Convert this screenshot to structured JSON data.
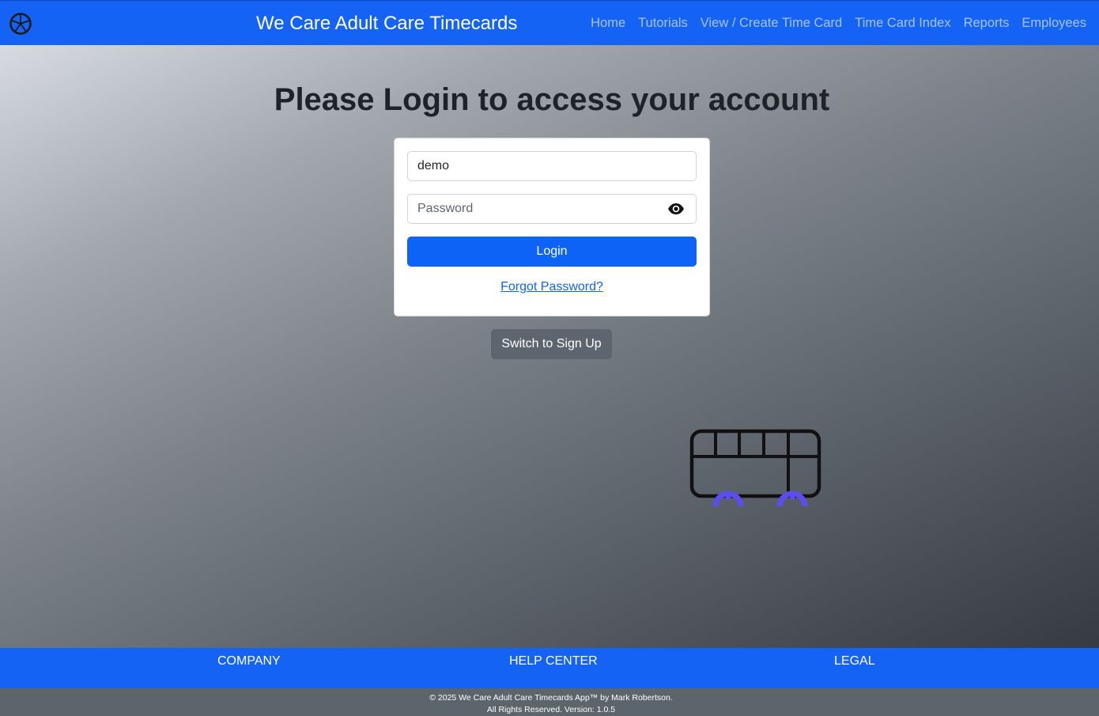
{
  "header": {
    "title": "We Care Adult Care Timecards",
    "logo_icon": "wheel-icon",
    "nav": [
      {
        "label": "Home"
      },
      {
        "label": "Tutorials"
      },
      {
        "label": "View / Create Time Card"
      },
      {
        "label": "Time Card Index"
      },
      {
        "label": "Reports"
      },
      {
        "label": "Employees"
      }
    ]
  },
  "main": {
    "heading": "Please Login to access your account",
    "login_form": {
      "username_value": "demo",
      "password_value": "",
      "password_placeholder": "Password",
      "show_password_icon": "eye-icon",
      "login_label": "Login",
      "forgot_label": "Forgot Password?"
    },
    "switch_label": "Switch to Sign Up",
    "illustration_icon": "bus-icon"
  },
  "footer": {
    "links": [
      {
        "label": "COMPANY"
      },
      {
        "label": "HELP CENTER"
      },
      {
        "label": "LEGAL"
      }
    ],
    "copyright_line1": "© 2025 We Care Adult Care Timecards App™ by Mark Robertson.",
    "copyright_line2": "All Rights Reserved. Version: 1.0.5"
  },
  "colors": {
    "brand_blue": "#1563f4",
    "button_blue": "#0d63f6",
    "secondary_gray": "#5d666e",
    "wheel_accent": "#5b4df0"
  }
}
